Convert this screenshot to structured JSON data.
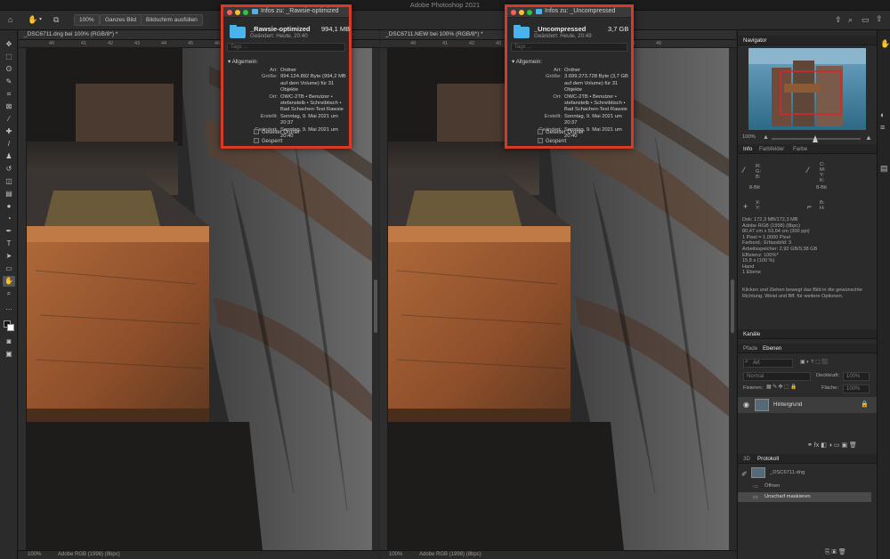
{
  "app_title": "Adobe Photoshop 2021",
  "options": {
    "zoom": "100%",
    "fit_screen": "Ganzes Bild",
    "fill_screen": "Bildschirm ausfüllen"
  },
  "left_doc": {
    "tab": "_DSC6711.dng bei 100% (RGB/8*) *",
    "ruler_ticks": [
      "40",
      "41",
      "42",
      "43",
      "44",
      "45",
      "46",
      "47",
      "48",
      "49"
    ],
    "status_zoom": "100%",
    "status_info": "Adobe RGB (1998) (8bpc)",
    "info": {
      "window_title": "Infos zu: _Rawsie-optimized",
      "name": "_Rawsie-optimized",
      "size": "994,1 MB",
      "changed": "Geändert: Heute, 20:40",
      "tags_placeholder": "Tags ...",
      "section": "Allgemein:",
      "rows": [
        {
          "k": "Art:",
          "v": "Ordner"
        },
        {
          "k": "Größe:",
          "v": "994.124.892 Byte (994,2 MB auf dem Volume) für 31 Objekte"
        },
        {
          "k": "Ort:",
          "v": "OWC-2TB • Benutzer • stefanstelb • Schreibtisch • Bad Schachen-Test Rawsie"
        },
        {
          "k": "Erstellt:",
          "v": "Sonntag, 9. Mai 2021 um 20:37"
        },
        {
          "k": "Geändert:",
          "v": "Sonntag, 9. Mai 2021 um 20:40"
        }
      ],
      "shared": "Geteilter Ordner",
      "locked": "Gesperrt"
    }
  },
  "right_doc": {
    "tab": "_DSC6711.NEW bei 100% (RGB/8*) *",
    "ruler_ticks": [
      "40",
      "41",
      "42",
      "43",
      "44",
      "45",
      "46",
      "47",
      "48",
      "49"
    ],
    "status_zoom": "100%",
    "status_info": "Adobe RGB (1998) (8bpc)",
    "info": {
      "window_title": "Infos zu: _Uncompressed",
      "name": "_Uncompressed",
      "size": "3,7 GB",
      "changed": "Geändert: Heute, 20:49",
      "tags_placeholder": "Tags ...",
      "section": "Allgemein:",
      "rows": [
        {
          "k": "Art:",
          "v": "Ordner"
        },
        {
          "k": "Größe:",
          "v": "3.699.273.728 Byte (3,7 GB auf dem Volume) für 31 Objekte"
        },
        {
          "k": "Ort:",
          "v": "OWC-2TB • Benutzer • stefanstelb • Schreibtisch • Bad Schachen-Test Rawsie"
        },
        {
          "k": "Erstellt:",
          "v": "Sonntag, 9. Mai 2021 um 20:37"
        },
        {
          "k": "Geändert:",
          "v": "Sonntag, 9. Mai 2021 um 20:40"
        }
      ],
      "shared": "Geteilter Ordner",
      "locked": "Gesperrt"
    }
  },
  "panels": {
    "navigator": {
      "tab": "Navigator",
      "zoom": "100%"
    },
    "info_tabs": [
      "Info",
      "Farbfelder",
      "Farbe"
    ],
    "info_text": [
      "Dok: 172,3 MB/172,3 MB",
      "Adobe RGB (1998) (8bpc)",
      "80,47 cm x 53,64 cm (300 ppi)",
      "1 Pixel = 1,0000 Pixel",
      "Farbord.: Erfassbild: 3",
      "Arbeitsspeicher: 2,92 GB/9,38 GB",
      "Effizienz: 100%*",
      "15,8 s (100 %)",
      "Hand",
      "1 Ebene"
    ],
    "info_hint": "Klicken und Ziehen bewegt das Bild in die gewünschte Richtung. Weist und Bff. für weitere Optionen.",
    "channels_tab": "Kanäle",
    "layers_tabs": [
      "Pfade",
      "Ebenen"
    ],
    "layer_filter": "Art",
    "blend_mode": "Normal",
    "opacity_label": "Deckkraft:",
    "opacity": "100%",
    "fix_label": "Fixieren:",
    "fill_label": "Fläche:",
    "fill": "100%",
    "layer_name": "Hintergrund",
    "history_tabs": [
      "3D",
      "Protokoll"
    ],
    "history_file": "_DSC6711.dng",
    "history_items": [
      "Öffnen",
      "Unscharf maskieren"
    ]
  }
}
